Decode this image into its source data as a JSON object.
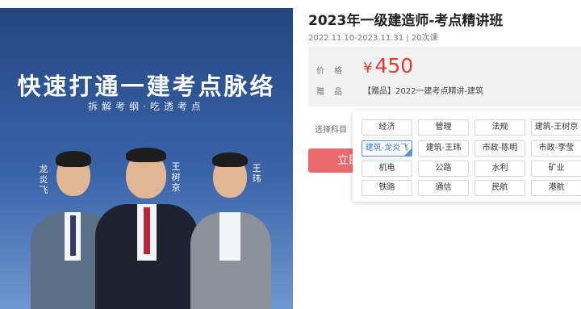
{
  "banner": {
    "title": "快速打通一建考点脉络",
    "subtitle": "拆解考纲·吃透考点",
    "teachers": [
      "龙炎飞",
      "王树京",
      "王玮"
    ]
  },
  "course": {
    "title": "2023年一级建造师-考点精讲班",
    "meta": "2022.11.10-2023.11.31 | 20次课"
  },
  "price": {
    "label": "价格",
    "currency": "¥",
    "value": "450",
    "color": "#e8382f"
  },
  "gift": {
    "label": "赠品",
    "text": "【赠品】2022一建考点精讲-建筑"
  },
  "subject": {
    "label": "选择科目",
    "accent": "#5b8fd9",
    "options": [
      {
        "label": "经济",
        "selected": false
      },
      {
        "label": "管理",
        "selected": false
      },
      {
        "label": "法规",
        "selected": false
      },
      {
        "label": "建筑-王树京",
        "selected": false
      },
      {
        "label": "建筑-龙炎飞",
        "selected": true
      },
      {
        "label": "建筑-王玮",
        "selected": false
      },
      {
        "label": "市政-陈明",
        "selected": false
      },
      {
        "label": "市政-李莹",
        "selected": false
      },
      {
        "label": "机电",
        "selected": false
      },
      {
        "label": "公路",
        "selected": false
      },
      {
        "label": "水利",
        "selected": false
      },
      {
        "label": "矿业",
        "selected": false
      },
      {
        "label": "铁路",
        "selected": false
      },
      {
        "label": "通信",
        "selected": false
      },
      {
        "label": "民航",
        "selected": false
      },
      {
        "label": "港航",
        "selected": false
      }
    ]
  },
  "buy_button": {
    "label": "立即"
  }
}
